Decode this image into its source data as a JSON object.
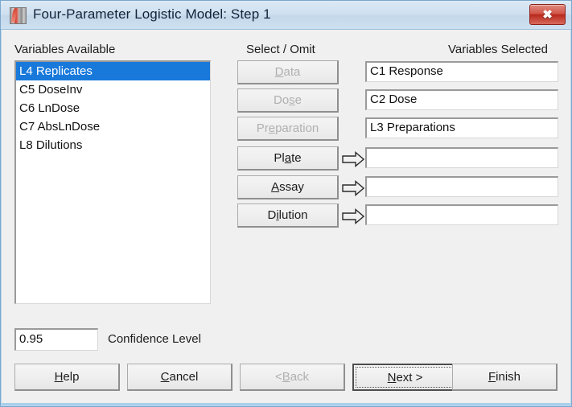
{
  "window": {
    "title": "Four-Parameter Logistic Model: Step 1",
    "icon": "minitab-app-icon",
    "close_label": "✖",
    "border_color": "#a7cfeb",
    "titlebar_color": "#cfe0f0",
    "close_button_color": "#c23b2c"
  },
  "panels": {
    "available_header": "Variables Available",
    "middle_header": "Select / Omit",
    "selected_header": "Variables Selected"
  },
  "available_variables": [
    {
      "label": "L4 Replicates",
      "selected": true
    },
    {
      "label": "C5 DoseInv",
      "selected": false
    },
    {
      "label": "C6 LnDose",
      "selected": false
    },
    {
      "label": "C7 AbsLnDose",
      "selected": false
    },
    {
      "label": "L8 Dilutions",
      "selected": false
    }
  ],
  "select_omit_buttons": [
    {
      "label": "Data",
      "accel": "D",
      "before": "",
      "after": "ata",
      "enabled": false,
      "has_arrow": false
    },
    {
      "label": "Dose",
      "accel": "s",
      "before": "Do",
      "after": "e",
      "enabled": false,
      "has_arrow": false
    },
    {
      "label": "Preparation",
      "accel": "e",
      "before": "Pr",
      "after": "paration",
      "enabled": false,
      "has_arrow": false
    },
    {
      "label": "Plate",
      "accel": "a",
      "before": "Pl",
      "after": "te",
      "enabled": true,
      "has_arrow": true
    },
    {
      "label": "Assay",
      "accel": "A",
      "before": "",
      "after": "ssay",
      "enabled": true,
      "has_arrow": true
    },
    {
      "label": "Dilution",
      "accel": "i",
      "before": "D",
      "after": "lution",
      "enabled": true,
      "has_arrow": true
    }
  ],
  "selected_fields": [
    {
      "value": "C1 Response"
    },
    {
      "value": "C2 Dose"
    },
    {
      "value": "L3 Preparations"
    },
    {
      "value": ""
    },
    {
      "value": ""
    },
    {
      "value": ""
    }
  ],
  "confidence": {
    "value": "0.95",
    "label": "Confidence Level"
  },
  "dialog_buttons": [
    {
      "label": "Help",
      "accel": "H",
      "before": "",
      "after": "elp",
      "enabled": true,
      "is_default": false
    },
    {
      "label": "Cancel",
      "accel": "C",
      "before": "",
      "after": "ancel",
      "enabled": true,
      "is_default": false
    },
    {
      "label": "< Back",
      "accel": "B",
      "before": "< ",
      "after": "ack",
      "enabled": false,
      "is_default": false
    },
    {
      "label": "Next >",
      "accel": "N",
      "before": "",
      "after": "ext >",
      "enabled": true,
      "is_default": true
    },
    {
      "label": "Finish",
      "accel": "F",
      "before": "",
      "after": "inish",
      "enabled": true,
      "is_default": false
    }
  ],
  "arrow_glyph": "double-right-arrow"
}
